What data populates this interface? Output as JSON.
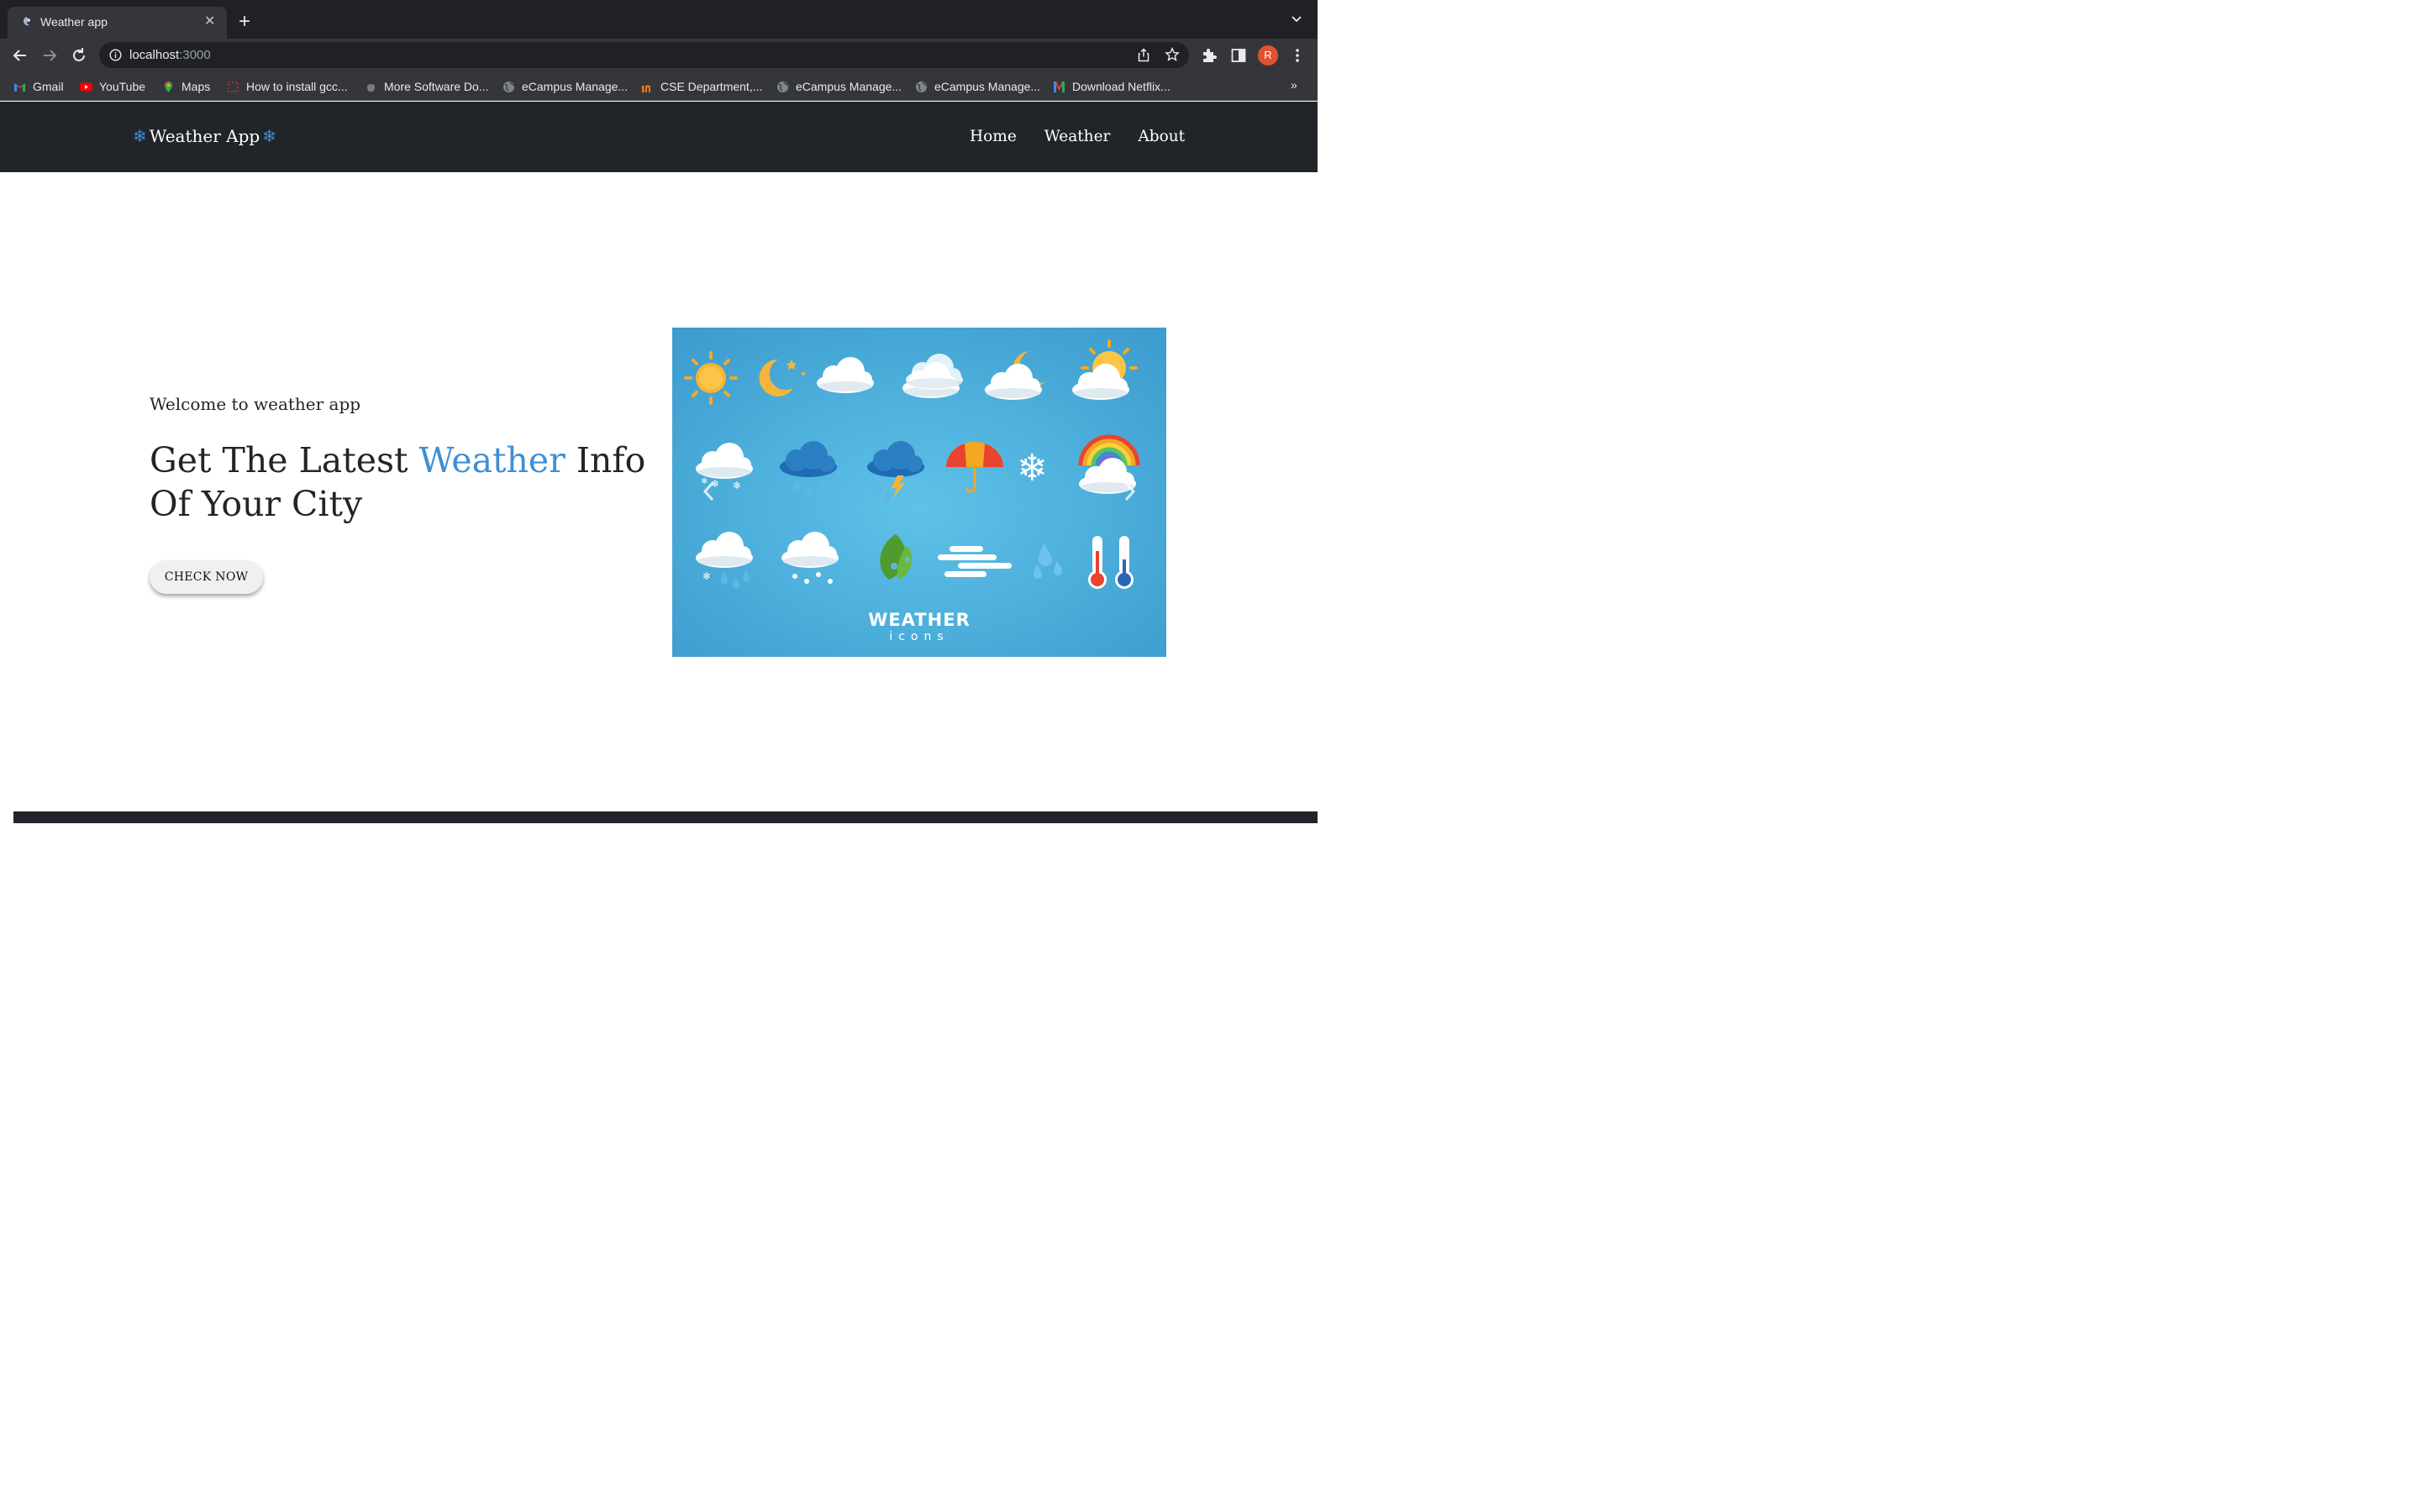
{
  "browser": {
    "tab_title": "Weather app",
    "url_host": "localhost",
    "url_port": ":3000",
    "profile_initial": "R",
    "bookmarks": [
      {
        "label": "Gmail",
        "icon": "gmail-icon"
      },
      {
        "label": "YouTube",
        "icon": "youtube-icon"
      },
      {
        "label": "Maps",
        "icon": "maps-icon"
      },
      {
        "label": "How to install gcc...",
        "icon": "bookmark-icon"
      },
      {
        "label": "More Software Do...",
        "icon": "apple-icon"
      },
      {
        "label": "eCampus Manage...",
        "icon": "globe-icon"
      },
      {
        "label": "CSE Department,...",
        "icon": "department-icon"
      },
      {
        "label": "eCampus Manage...",
        "icon": "globe-icon"
      },
      {
        "label": "eCampus Manage...",
        "icon": "globe-icon"
      },
      {
        "label": "Download Netflix...",
        "icon": "netflix-icon"
      }
    ],
    "more_bookmarks": "»"
  },
  "navbar": {
    "brand_flake": "❄",
    "brand": "Weather App",
    "links": [
      "Home",
      "Weather",
      "About"
    ]
  },
  "hero": {
    "subtitle": "Welcome to weather app",
    "title_before": "Get The Latest ",
    "title_accent": "Weather",
    "title_after": " Info Of Your City",
    "button": "CHECK NOW",
    "image_caption_line1": "WEATHER",
    "image_caption_line2": "icons"
  },
  "colors": {
    "navbar_bg": "#212529",
    "accent": "#3d8fd6",
    "image_bg": "#4aaad8"
  }
}
